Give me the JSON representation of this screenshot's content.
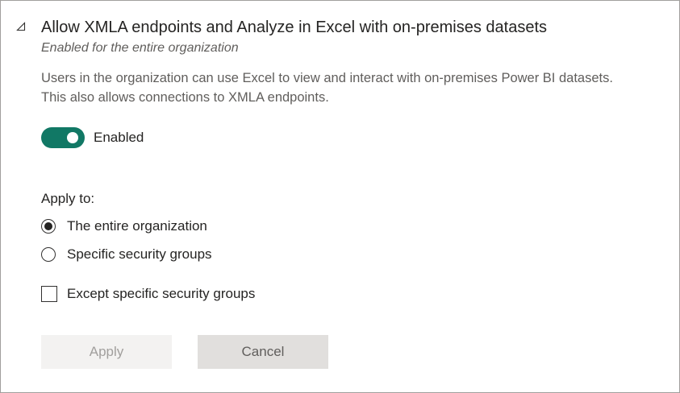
{
  "setting": {
    "title": "Allow XMLA endpoints and Analyze in Excel with on-premises datasets",
    "status": "Enabled for the entire organization",
    "description": "Users in the organization can use Excel to view and interact with on-premises Power BI datasets. This also allows connections to XMLA endpoints."
  },
  "toggle": {
    "label": "Enabled",
    "on": true,
    "color": "#117865"
  },
  "apply_to": {
    "label": "Apply to:",
    "options": [
      {
        "label": "The entire organization",
        "selected": true
      },
      {
        "label": "Specific security groups",
        "selected": false
      }
    ],
    "except_label": "Except specific security groups",
    "except_checked": false
  },
  "buttons": {
    "apply": "Apply",
    "cancel": "Cancel"
  },
  "icons": {
    "collapse": "collapse-triangle-icon"
  }
}
